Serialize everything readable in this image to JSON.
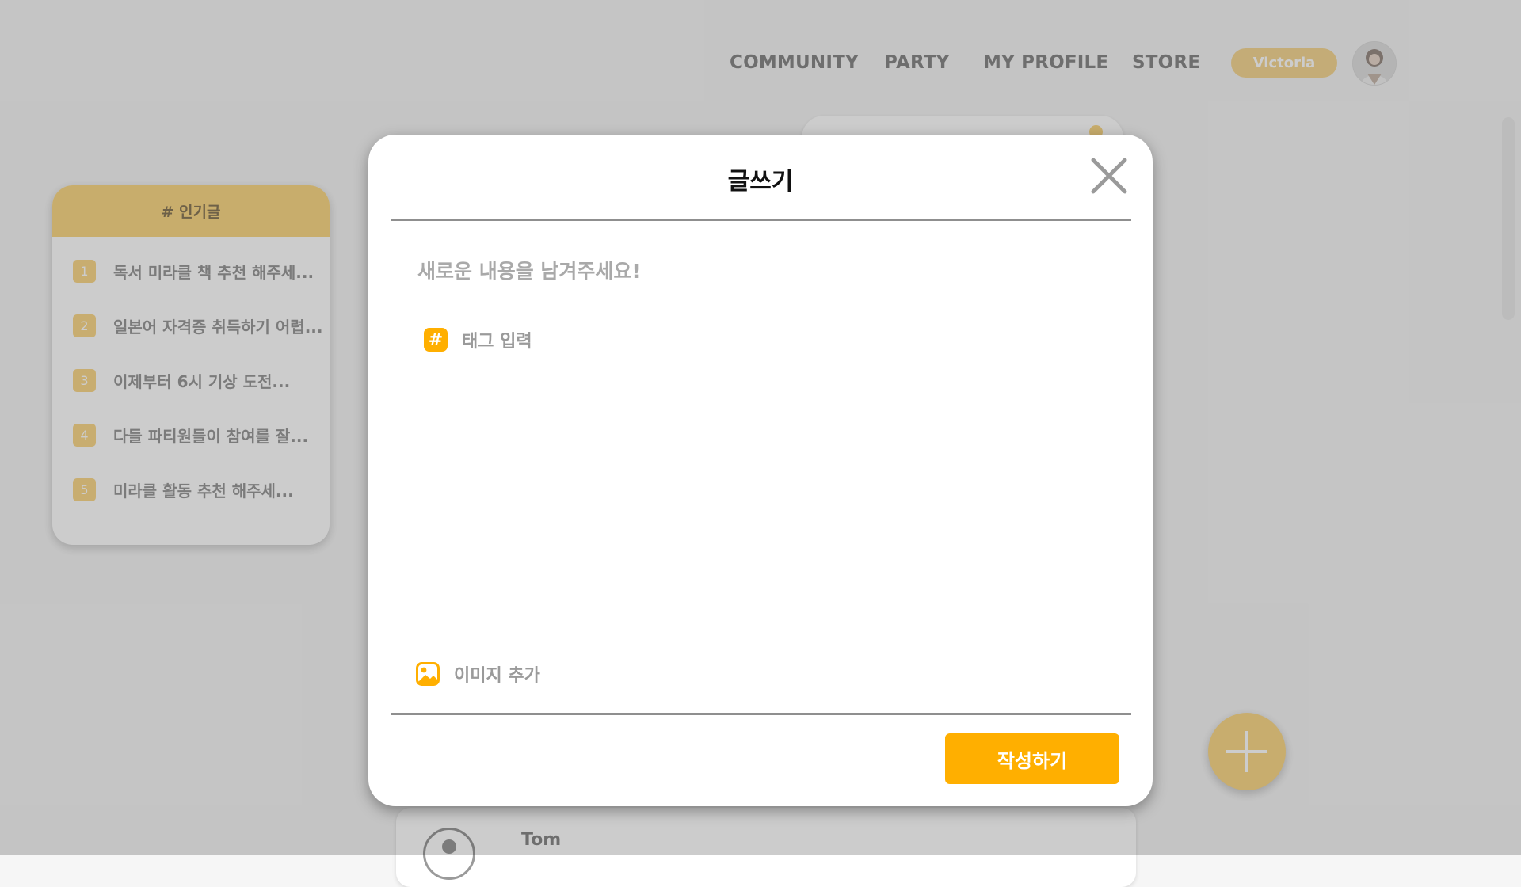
{
  "nav": {
    "items": [
      "COMMUNITY",
      "PARTY",
      "MY PROFILE",
      "STORE"
    ],
    "username": "Victoria"
  },
  "popular": {
    "header": "# 인기글",
    "items": [
      {
        "rank": "1",
        "text": "독서 미라클 책 추천 해주세..."
      },
      {
        "rank": "2",
        "text": "일본어 자격증 취득하기 어렵..."
      },
      {
        "rank": "3",
        "text": "이제부터 6시 기상 도전..."
      },
      {
        "rank": "4",
        "text": "다들 파티원들이 참여를 잘..."
      },
      {
        "rank": "5",
        "text": "미라클 활동 추천 해주세..."
      }
    ]
  },
  "post": {
    "author": "Tom"
  },
  "modal": {
    "title": "글쓰기",
    "content_placeholder": "새로운 내용을 남겨주세요!",
    "tag_icon": "#",
    "tag_label": "태그 입력",
    "image_label": "이미지 추가",
    "submit_label": "작성하기"
  },
  "colors": {
    "accent": "#ffaf00",
    "accent_soft": "#fbd987",
    "overlay": "rgba(0,0,0,0.2)"
  },
  "icons": {
    "close": "close-icon",
    "tag": "hash-icon",
    "image": "image-icon",
    "add": "plus-icon",
    "profile": "user-icon"
  }
}
